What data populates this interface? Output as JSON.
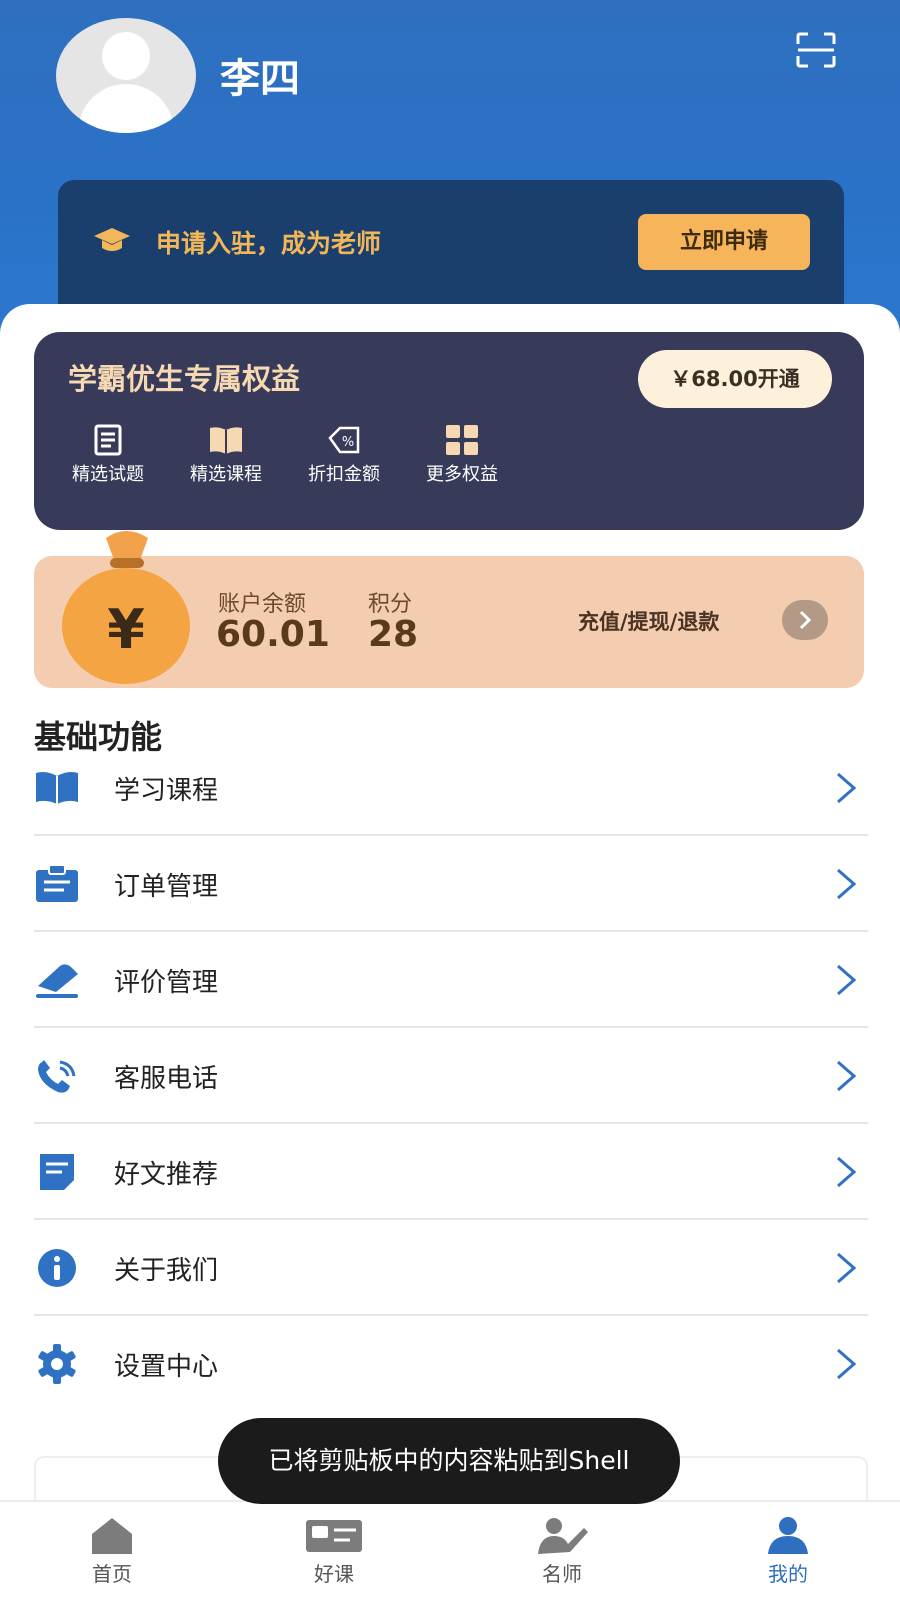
{
  "profile": {
    "name": "李四"
  },
  "apply_banner": {
    "text": "申请入驻，成为老师",
    "button": "立即申请"
  },
  "vip": {
    "title": "学霸优生专属权益",
    "button": "￥68.00开通",
    "benefits": [
      {
        "label": "精选试题",
        "icon": "question-bank-icon"
      },
      {
        "label": "精选课程",
        "icon": "book-icon"
      },
      {
        "label": "折扣金额",
        "icon": "discount-tag-icon"
      },
      {
        "label": "更多权益",
        "icon": "grid-icon"
      }
    ]
  },
  "account": {
    "balance_label": "账户余额",
    "balance_value": "60.01",
    "points_label": "积分",
    "points_value": "28",
    "action_text": "充值/提现/退款"
  },
  "basic_functions": {
    "title": "基础功能",
    "items": [
      {
        "label": "学习课程",
        "icon": "open-book-icon"
      },
      {
        "label": "订单管理",
        "icon": "clipboard-icon"
      },
      {
        "label": "评价管理",
        "icon": "review-icon"
      },
      {
        "label": "客服电话",
        "icon": "phone-icon"
      },
      {
        "label": "好文推荐",
        "icon": "article-icon"
      },
      {
        "label": "关于我们",
        "icon": "info-icon"
      },
      {
        "label": "设置中心",
        "icon": "settings-gear-icon"
      }
    ]
  },
  "toast": {
    "text": "已将剪贴板中的内容粘贴到Shell"
  },
  "tabbar": {
    "items": [
      {
        "label": "首页",
        "icon": "home-icon"
      },
      {
        "label": "好课",
        "icon": "course-icon"
      },
      {
        "label": "名师",
        "icon": "teacher-icon"
      },
      {
        "label": "我的",
        "icon": "profile-icon"
      }
    ],
    "active": "我的"
  },
  "colors": {
    "header_blue": "#2f6fbf",
    "accent_orange": "#f6b55a",
    "vip_bg": "#383a5a",
    "balance_bg": "#f4ccb0",
    "icon_blue": "#2f72c4"
  }
}
